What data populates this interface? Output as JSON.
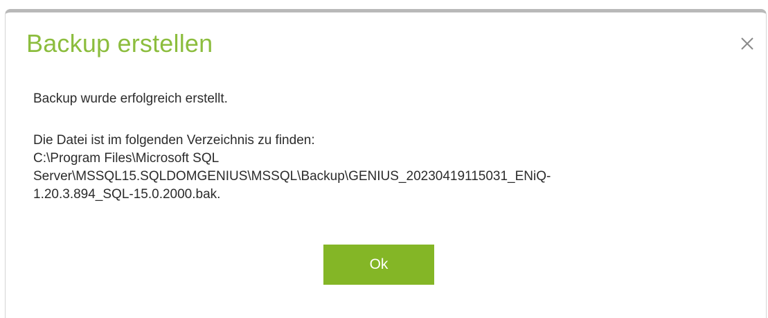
{
  "dialog": {
    "title": "Backup erstellen",
    "close_icon": "close-icon",
    "success_message": "Backup wurde erfolgreich erstellt.",
    "location_label": "Die Datei ist im folgenden Verzeichnis zu finden:",
    "file_path_lines": [
      "C:\\Program Files\\Microsoft SQL",
      "Server\\MSSQL15.SQLDOMGENIUS\\MSSQL\\Backup\\GENIUS_20230419115031_ENiQ-",
      "1.20.3.894_SQL-15.0.2000.bak."
    ],
    "ok_label": "Ok"
  },
  "colors": {
    "title": "#8cbd3e",
    "button": "#84b626",
    "text": "#2b2b2b",
    "header_border": "#b9b9b9"
  }
}
